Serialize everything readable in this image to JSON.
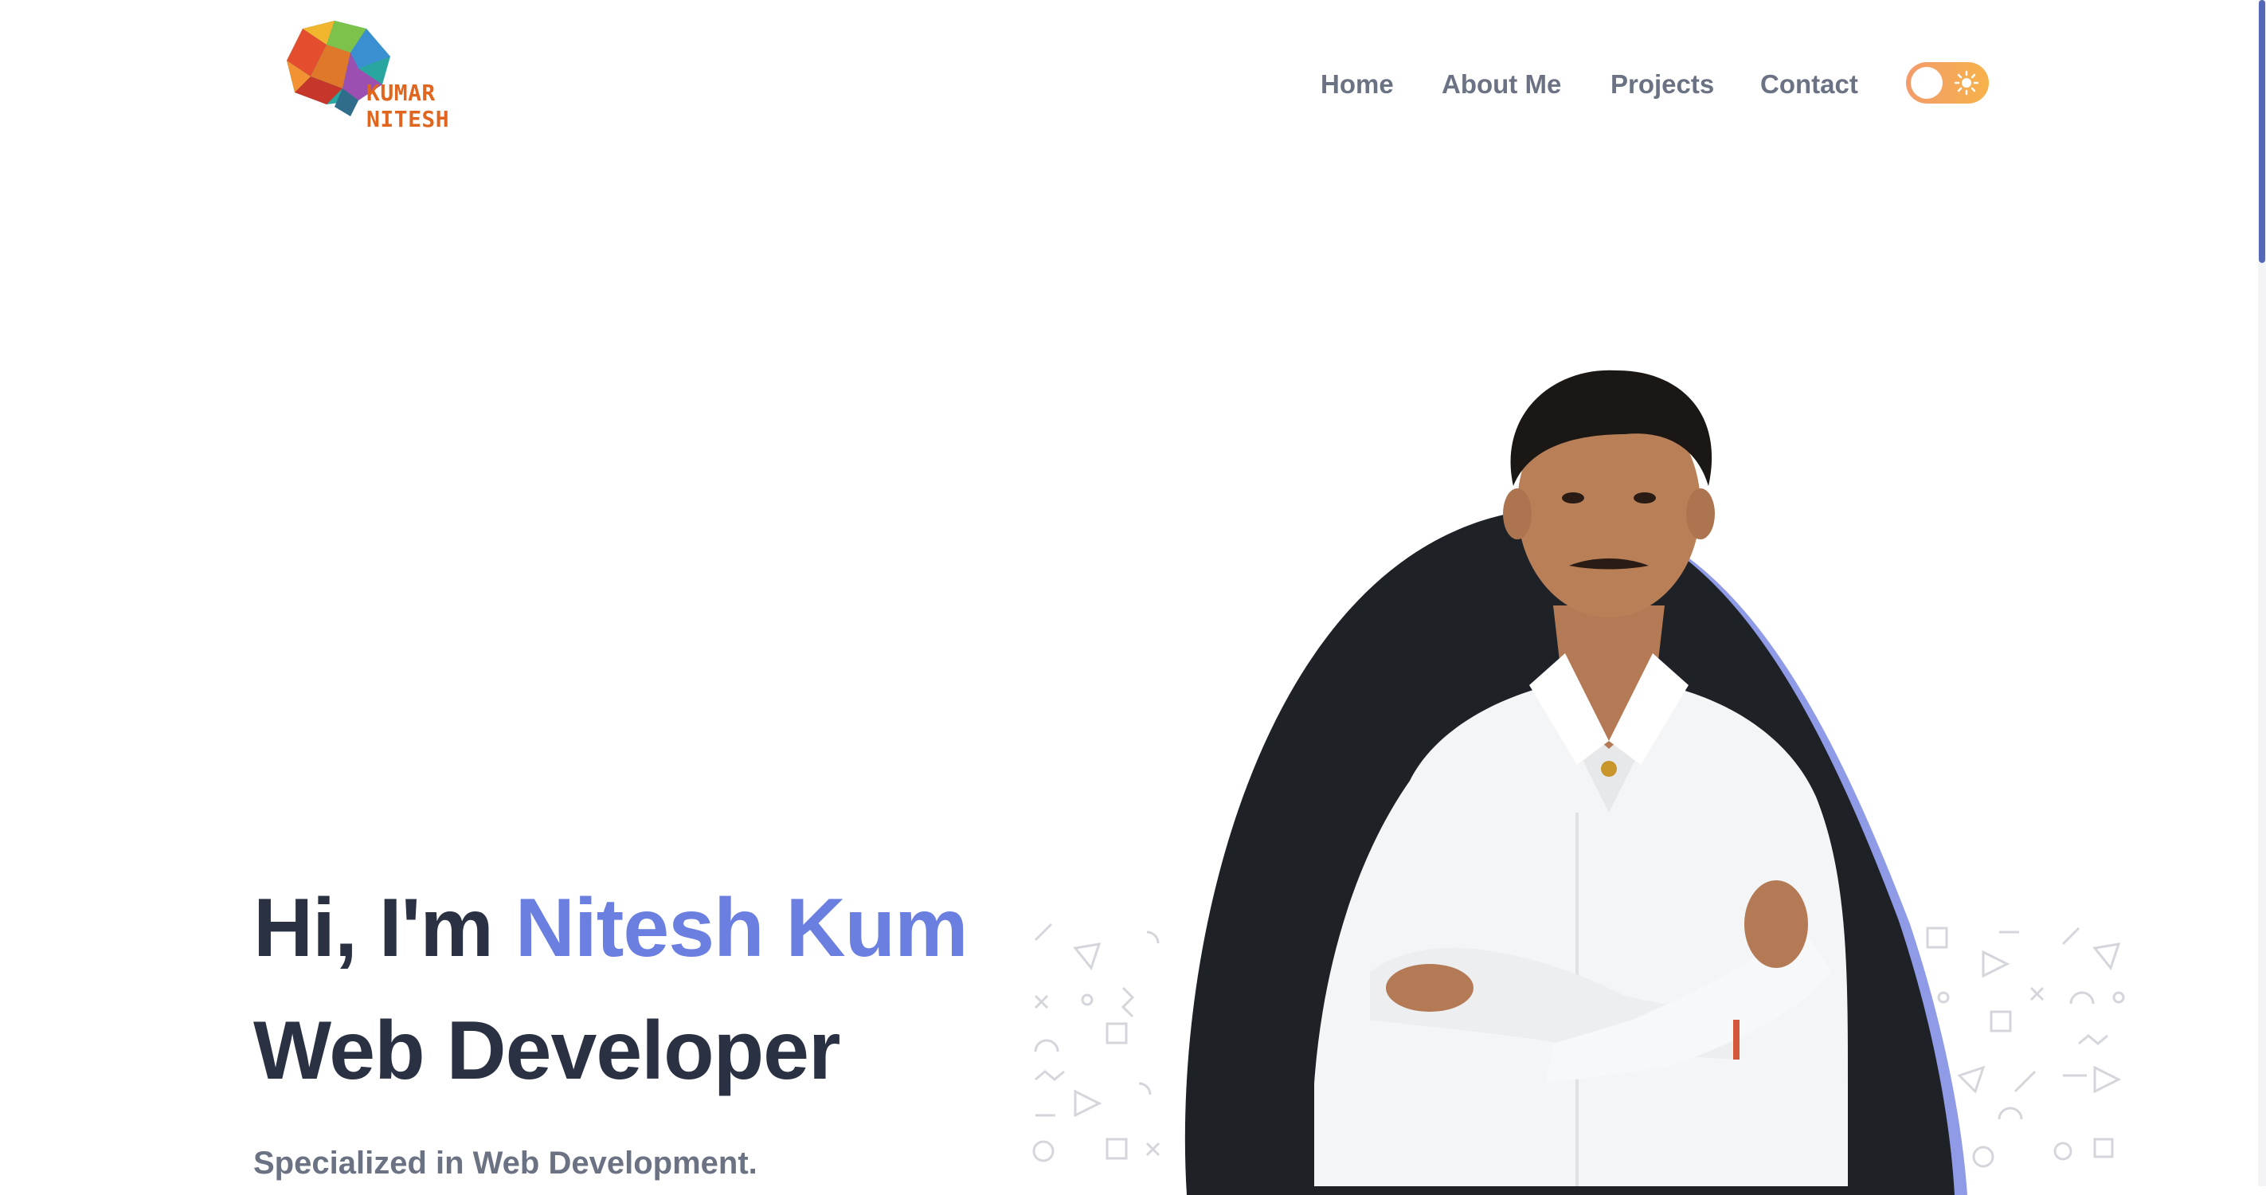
{
  "header": {
    "logo_text": "KUMAR NITESH",
    "nav": [
      {
        "label": "Home"
      },
      {
        "label": "About Me"
      },
      {
        "label": "Projects"
      },
      {
        "label": "Contact"
      }
    ],
    "theme_toggle": {
      "state": "light",
      "icon": "sun-icon"
    }
  },
  "hero": {
    "greeting": "Hi, I'm ",
    "name_typed": "Nitesh Kum",
    "role": "Web Developer",
    "subtitle": "Specialized in Web Development."
  },
  "colors": {
    "accent": "#6b7fe0",
    "heading": "#2a3142",
    "muted": "#6b7283",
    "blob": "#1e2227",
    "toggle_gradient_start": "#f39b6b",
    "toggle_gradient_end": "#f6b24a"
  }
}
